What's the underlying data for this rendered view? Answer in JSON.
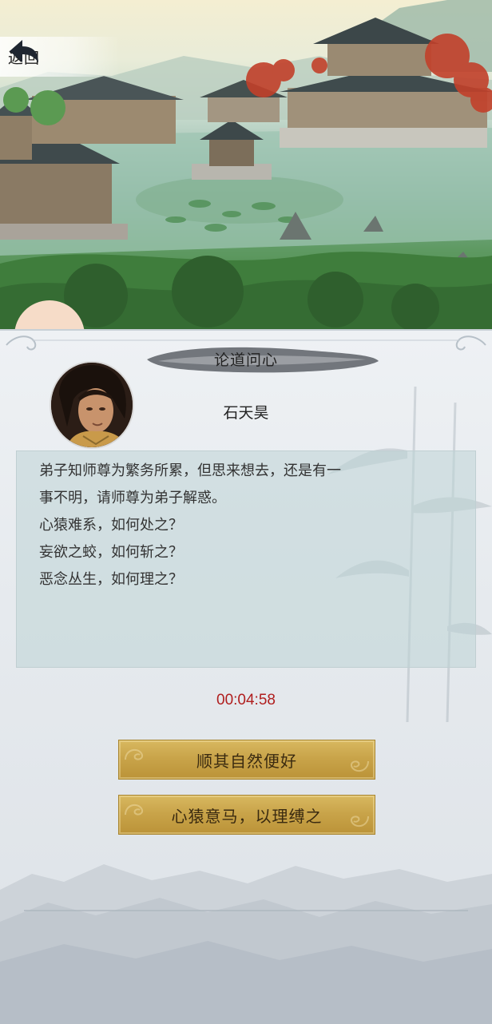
{
  "nav": {
    "back_label": "返回"
  },
  "dialog": {
    "title": "论道问心",
    "speaker": "石天昊",
    "lines": [
      "弟子知师尊为繁务所累，但思来想去，还是有一",
      "事不明，请师尊为弟子解惑。",
      "心猿难系，如何处之？",
      "妄欲之蛟，如何斩之？",
      "恶念丛生，如何理之？"
    ],
    "timer": "00:04:58",
    "options": [
      {
        "label": "顺其自然便好"
      },
      {
        "label": "心猿意马，以理缚之"
      }
    ]
  },
  "colors": {
    "timer": "#b01e1e",
    "option_gold": "#c9a44a",
    "panel_bg": "#e6eaee"
  },
  "icons": {
    "back": "back-arrow-icon"
  }
}
